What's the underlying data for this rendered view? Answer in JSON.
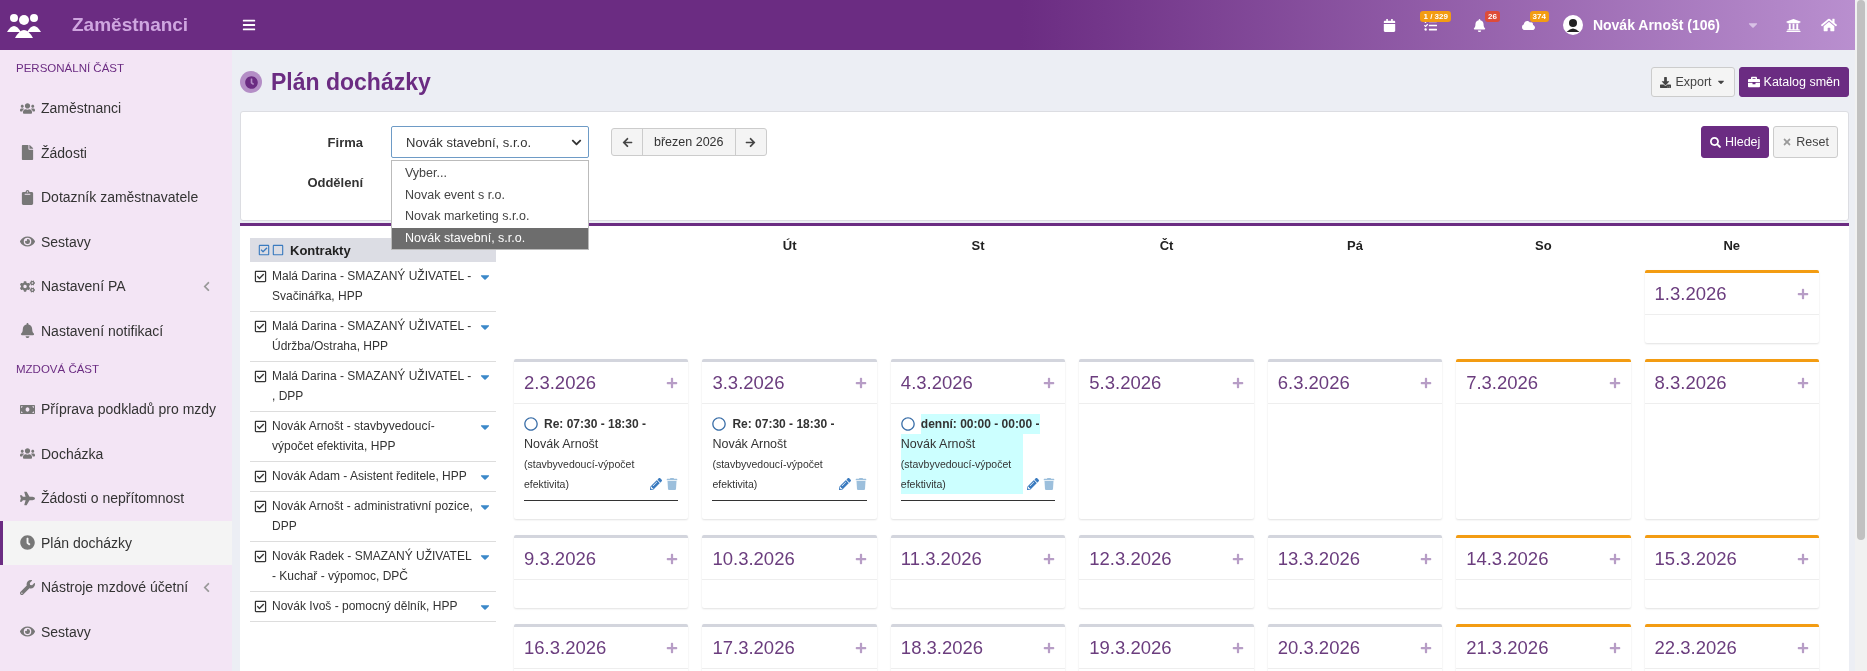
{
  "topbar": {
    "app_name": "Zaměstnanci",
    "badges": [
      {
        "text": "1 / 329",
        "color": "#f39c12"
      },
      {
        "text": "26",
        "color": "#dd4b39"
      },
      {
        "text": "374",
        "color": "#f39c12"
      }
    ],
    "user": "Novák Arnošt (106)"
  },
  "sidebar": {
    "sections": [
      {
        "title": "PERSONÁLNÍ ČÁST",
        "items": [
          {
            "label": "Zaměstnanci",
            "selected": false,
            "expandable": false
          },
          {
            "label": "Žádosti",
            "selected": false,
            "expandable": false
          },
          {
            "label": "Dotazník zaměstnavatele",
            "selected": false,
            "expandable": false
          },
          {
            "label": "Sestavy",
            "selected": false,
            "expandable": false
          },
          {
            "label": "Nastavení PA",
            "selected": false,
            "expandable": true
          },
          {
            "label": "Nastavení notifikací",
            "selected": false,
            "expandable": false
          }
        ]
      },
      {
        "title": "MZDOVÁ ČÁST",
        "items": [
          {
            "label": "Příprava podkladů pro mzdy",
            "selected": false,
            "expandable": false
          },
          {
            "label": "Docházka",
            "selected": false,
            "expandable": false
          },
          {
            "label": "Žádosti o nepřítomnost",
            "selected": false,
            "expandable": false
          },
          {
            "label": "Plán docházky",
            "selected": true,
            "expandable": false
          },
          {
            "label": "Nástroje mzdové účetní",
            "selected": false,
            "expandable": true
          },
          {
            "label": "Sestavy",
            "selected": false,
            "expandable": false
          }
        ]
      }
    ]
  },
  "page_title": "Plán docházky",
  "header_buttons": {
    "export": "Export",
    "catalog": "Katalog směn"
  },
  "filters": {
    "company_label": "Firma",
    "company_value": "Novák stavební, s.r.o.",
    "department_label": "Oddělení",
    "month": "březen 2026",
    "search": "Hledej",
    "reset": "Reset",
    "dropdown": [
      {
        "label": "Vyber...",
        "selected": false
      },
      {
        "label": "Novak event s r.o.",
        "selected": false
      },
      {
        "label": "Novak marketing s.r.o.",
        "selected": false
      },
      {
        "label": "Novák stavební, s.r.o.",
        "selected": true
      }
    ]
  },
  "contracts": {
    "title": "Kontrakty",
    "items": [
      {
        "label": "Malá Darina - SMAZANÝ UŽIVATEL - Svačinářka, HPP",
        "checked": true
      },
      {
        "label": "Malá Darina - SMAZANÝ UŽIVATEL - Údržba/Ostraha, HPP",
        "checked": true
      },
      {
        "label": "Malá Darina - SMAZANÝ UŽIVATEL - , DPP",
        "checked": true
      },
      {
        "label": "Novák Arnošt - stavbyvedoucí-výpočet efektivita, HPP",
        "checked": true
      },
      {
        "label": "Novák Adam - Asistent ředitele, HPP",
        "checked": true
      },
      {
        "label": "Novák Arnošt - administrativní pozice, DPP",
        "checked": true
      },
      {
        "label": "Novák Radek - SMAZANÝ UŽIVATEL - Kuchař - výpomoc, DPČ",
        "checked": true
      },
      {
        "label": "Novák Ivoš - pomocný dělník, HPP",
        "checked": true
      }
    ]
  },
  "calendar": {
    "day_headers": [
      "Út",
      "St",
      "Čt",
      "Pá",
      "So",
      "Ne"
    ],
    "weeks": [
      {
        "days": [
          {
            "date": "1.3.2026",
            "weekend": true
          }
        ]
      },
      {
        "days": [
          {
            "date": "2.3.2026",
            "weekend": false,
            "events": [
              {
                "title": "Re: 07:30 - 18:30 -",
                "person": "Novák Arnošt",
                "role": "(stavbyvedoucí-výpočet efektivita)",
                "highlighted": false
              }
            ]
          },
          {
            "date": "3.3.2026",
            "weekend": false,
            "events": [
              {
                "title": "Re: 07:30 - 18:30 -",
                "person": "Novák Arnošt",
                "role": "(stavbyvedoucí-výpočet efektivita)",
                "highlighted": false
              }
            ]
          },
          {
            "date": "4.3.2026",
            "weekend": false,
            "events": [
              {
                "title": "denní: 00:00 - 00:00 -",
                "person": "Novák Arnošt",
                "role": "(stavbyvedoucí-výpočet efektivita)",
                "highlighted": true
              }
            ]
          },
          {
            "date": "5.3.2026",
            "weekend": false
          },
          {
            "date": "6.3.2026",
            "weekend": false
          },
          {
            "date": "7.3.2026",
            "weekend": true
          },
          {
            "date": "8.3.2026",
            "weekend": true
          }
        ]
      },
      {
        "days": [
          {
            "date": "9.3.2026",
            "weekend": false
          },
          {
            "date": "10.3.2026",
            "weekend": false
          },
          {
            "date": "11.3.2026",
            "weekend": false
          },
          {
            "date": "12.3.2026",
            "weekend": false
          },
          {
            "date": "13.3.2026",
            "weekend": false
          },
          {
            "date": "14.3.2026",
            "weekend": true
          },
          {
            "date": "15.3.2026",
            "weekend": true
          }
        ]
      },
      {
        "days": [
          {
            "date": "16.3.2026",
            "weekend": false
          },
          {
            "date": "17.3.2026",
            "weekend": false
          },
          {
            "date": "18.3.2026",
            "weekend": false
          },
          {
            "date": "19.3.2026",
            "weekend": false
          },
          {
            "date": "20.3.2026",
            "weekend": false
          },
          {
            "date": "21.3.2026",
            "weekend": true
          },
          {
            "date": "22.3.2026",
            "weekend": true
          }
        ]
      }
    ]
  }
}
